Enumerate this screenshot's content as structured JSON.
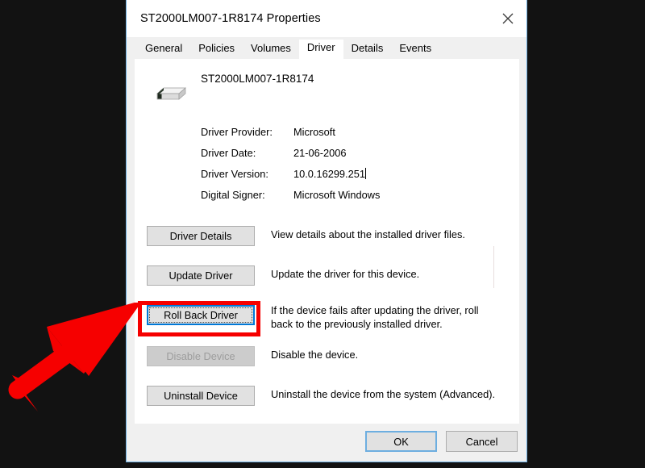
{
  "window": {
    "title": "ST2000LM007-1R8174 Properties",
    "close_icon": "close-icon",
    "border_color": "#6daee0",
    "backdrop_color": "#121212"
  },
  "tabs": [
    {
      "label": "General",
      "selected": false
    },
    {
      "label": "Policies",
      "selected": false
    },
    {
      "label": "Volumes",
      "selected": false
    },
    {
      "label": "Driver",
      "selected": true
    },
    {
      "label": "Details",
      "selected": false
    },
    {
      "label": "Events",
      "selected": false
    }
  ],
  "device": {
    "icon": "disk-drive-icon",
    "name": "ST2000LM007-1R8174"
  },
  "driver_info": [
    {
      "label": "Driver Provider:",
      "value": "Microsoft"
    },
    {
      "label": "Driver Date:",
      "value": "21-06-2006"
    },
    {
      "label": "Driver Version:",
      "value": "10.0.16299.251"
    },
    {
      "label": "Digital Signer:",
      "value": "Microsoft Windows"
    }
  ],
  "actions": [
    {
      "button": "Driver Details",
      "description": "View details about the installed driver files.",
      "state": "normal"
    },
    {
      "button": "Update Driver",
      "description": "Update the driver for this device.",
      "state": "normal"
    },
    {
      "button": "Roll Back Driver",
      "description": "If the device fails after updating the driver, roll back to the previously installed driver.",
      "state": "focused"
    },
    {
      "button": "Disable Device",
      "description": "Disable the device.",
      "state": "disabled"
    },
    {
      "button": "Uninstall Device",
      "description": "Uninstall the device from the system (Advanced).",
      "state": "normal"
    }
  ],
  "footer": {
    "ok_label": "OK",
    "cancel_label": "Cancel"
  },
  "annotations": {
    "highlight_color": "#f60000",
    "focus_color": "#0078d7",
    "arrow_target": "roll-back-driver-button",
    "highlight_target": "roll-back-driver-button"
  }
}
